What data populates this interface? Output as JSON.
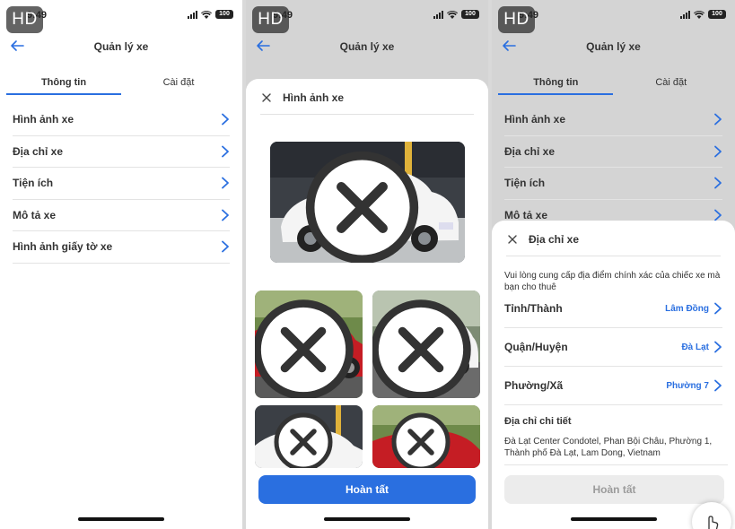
{
  "badge": "HD",
  "status_bar": {
    "time": "9:49",
    "battery": "100"
  },
  "colors": {
    "accent": "#2a6fe0",
    "text": "#333333",
    "divider": "#e3e3e3"
  },
  "screen1": {
    "nav_title": "Quản lý xe",
    "tabs": [
      {
        "label": "Thông tin",
        "active": true
      },
      {
        "label": "Cài đặt",
        "active": false
      }
    ],
    "menu": [
      {
        "label": "Hình ảnh xe"
      },
      {
        "label": "Địa chỉ xe"
      },
      {
        "label": "Tiện ích"
      },
      {
        "label": "Mô tả xe"
      },
      {
        "label": "Hình ảnh giấy tờ xe"
      }
    ]
  },
  "screen2": {
    "nav_title": "Quản lý xe",
    "sheet_title": "Hình ảnh xe",
    "photos": [
      {
        "name": "white-sedan-main",
        "car_color": "#f4f4f4"
      },
      {
        "name": "red-sedan",
        "car_color": "#c51d24"
      },
      {
        "name": "white-hatch",
        "car_color": "#f4f4f4"
      },
      {
        "name": "white-sedan-2",
        "car_color": "#f4f4f4"
      },
      {
        "name": "red-sedan-2",
        "car_color": "#c51d24"
      }
    ],
    "done_label": "Hoàn tất"
  },
  "screen3": {
    "nav_title": "Quản lý xe",
    "tabs": [
      {
        "label": "Thông tin",
        "active": true
      },
      {
        "label": "Cài đặt",
        "active": false
      }
    ],
    "menu": [
      {
        "label": "Hình ảnh xe"
      },
      {
        "label": "Địa chỉ xe"
      },
      {
        "label": "Tiện ích"
      },
      {
        "label": "Mô tả xe"
      }
    ],
    "sheet_title": "Địa chỉ xe",
    "note": "Vui lòng cung cấp địa điểm chính xác của chiếc xe mà bạn cho thuê",
    "fields": [
      {
        "label": "Tỉnh/Thành",
        "value": "Lâm Đồng"
      },
      {
        "label": "Quận/Huyện",
        "value": "Đà Lạt"
      },
      {
        "label": "Phường/Xã",
        "value": "Phường 7"
      }
    ],
    "detail_label": "Địa chỉ chi tiết",
    "detail_value": "Đà Lạt Center Condotel, Phan Bội Châu, Phường 1, Thành phố Đà Lạt, Lam Dong, Vietnam",
    "done_label": "Hoàn tất"
  },
  "icons": {
    "back": "back-arrow-icon",
    "chevron": "chevron-right-icon",
    "close": "close-icon",
    "remove": "remove-photo-icon",
    "corner": "hand-pointer-icon"
  }
}
